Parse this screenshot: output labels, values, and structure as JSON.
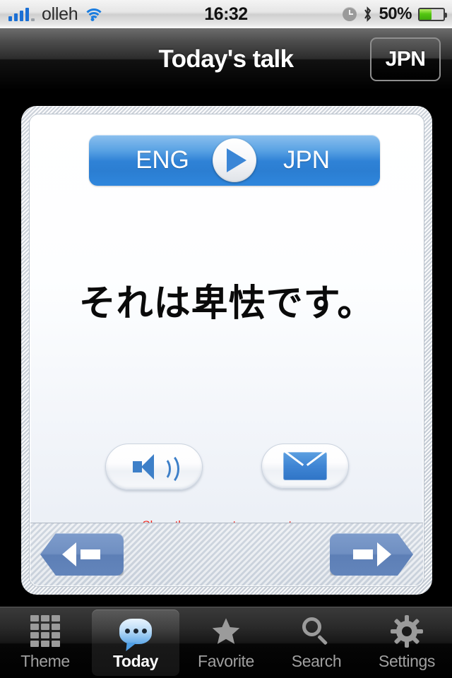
{
  "status_bar": {
    "carrier": "olleh",
    "time": "16:32",
    "battery_percent": "50%",
    "battery_level": 50,
    "signal_bars_filled": 4,
    "signal_bars_total": 5,
    "icons": [
      "signal-bars-icon",
      "wifi-icon",
      "clock-icon",
      "bluetooth-icon",
      "battery-icon"
    ]
  },
  "nav_bar": {
    "title": "Today's talk",
    "language_button": "JPN"
  },
  "card": {
    "direction_bar": {
      "source_language": "ENG",
      "target_language": "JPN",
      "play_icon": "play-icon"
    },
    "phrase": "それは卑怯です。",
    "actions": {
      "speak_icon": "speaker-icon",
      "mail_icon": "envelope-icon"
    },
    "hint": "Show the screen to your partner.",
    "hint_color": "#f0281e",
    "nav": {
      "prev_icon": "arrow-left-icon",
      "next_icon": "arrow-right-icon"
    }
  },
  "tab_bar": {
    "active_index": 1,
    "items": [
      {
        "label": "Theme",
        "icon": "grid-icon"
      },
      {
        "label": "Today",
        "icon": "speech-bubble-icon"
      },
      {
        "label": "Favorite",
        "icon": "star-icon"
      },
      {
        "label": "Search",
        "icon": "magnifier-icon"
      },
      {
        "label": "Settings",
        "icon": "gear-icon"
      }
    ]
  },
  "colors": {
    "accent_blue": "#2f82d6",
    "hint_red": "#f0281e",
    "arrow_blue": "#6f8fc2"
  }
}
